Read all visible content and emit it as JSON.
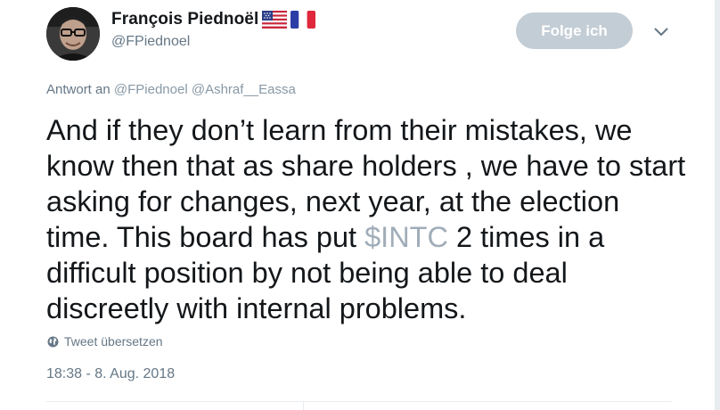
{
  "author": {
    "display_name": "François Piednoël",
    "screen_name": "@FPiednoel",
    "flags": [
      "us-flag",
      "fr-flag"
    ]
  },
  "follow_button": {
    "label": "Folge ich"
  },
  "reply_context": {
    "prefix": "Antwort an",
    "mentions": [
      "@FPiednoel",
      "@Ashraf__Eassa"
    ]
  },
  "tweet": {
    "text_before_cashtag": "And if they don’t learn from their mistakes, we know then that as share holders , we have to start asking for changes, next year, at the election time. This board has put ",
    "cashtag": "$INTC",
    "text_after_cashtag": " 2 times in a difficult position by not being able to deal discreetly with internal problems."
  },
  "translate": {
    "label": "Tweet übersetzen",
    "icon": "globe-icon"
  },
  "timestamp": "18:38 - 8. Aug. 2018",
  "colors": {
    "follow_button_bg": "#c3cdd5",
    "secondary_text": "#657786",
    "cashtag": "#a0adb8"
  }
}
